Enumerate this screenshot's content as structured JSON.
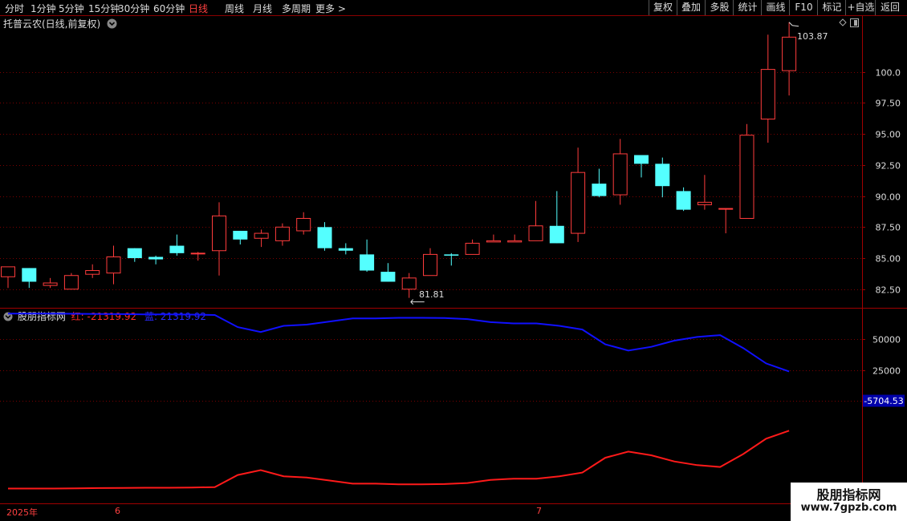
{
  "toolbar": {
    "periods": [
      "分时",
      "1分钟",
      "5分钟",
      "15分钟",
      "30分钟",
      "60分钟",
      "日线",
      "周线",
      "月线",
      "多周期",
      "更多 >"
    ],
    "active_period": "日线",
    "right_buttons": [
      "复权",
      "叠加",
      "多股",
      "统计",
      "画线",
      "F10",
      "标记",
      "+自选",
      "返回"
    ]
  },
  "main_panel": {
    "title": "托普云农(日线,前复权)",
    "y_ticks": [
      "100.0",
      "97.50",
      "95.00",
      "92.50",
      "90.00",
      "87.50",
      "85.00",
      "82.50"
    ],
    "high_label": "103.87",
    "low_label": "81.81"
  },
  "indicator_panel": {
    "name": "股朋指标网",
    "red_label": "红: -21319.92",
    "blue_label": "蓝: 21319.92",
    "y_ticks": [
      "50000",
      "25000"
    ],
    "current_value": "-5704.53"
  },
  "x_axis": {
    "year_label": "2025年",
    "month_labels": [
      "6",
      "7"
    ]
  },
  "watermark": {
    "title": "股朋指标网",
    "url": "www.7gpzb.com"
  },
  "colors": {
    "up": "#ff3c3c",
    "down": "#54ffff",
    "blue_line": "#1010ff",
    "red_line": "#ff1a1a",
    "grid": "#7a0000"
  },
  "chart_data": [
    {
      "type": "candlestick",
      "title": "托普云农(日线,前复权)",
      "ylim": [
        81,
        104.5
      ],
      "columns": [
        "open",
        "high",
        "low",
        "close"
      ],
      "candles": [
        [
          83.5,
          84.0,
          82.6,
          84.3
        ],
        [
          84.2,
          84.2,
          82.6,
          83.1
        ],
        [
          82.8,
          83.4,
          82.6,
          83.0
        ],
        [
          82.5,
          83.8,
          82.5,
          83.6
        ],
        [
          83.7,
          84.5,
          83.4,
          84.0
        ],
        [
          83.8,
          86.0,
          82.9,
          85.1
        ],
        [
          85.8,
          85.8,
          84.7,
          85.0
        ],
        [
          85.1,
          85.2,
          84.5,
          84.9
        ],
        [
          86.0,
          86.9,
          85.2,
          85.4
        ],
        [
          85.4,
          85.5,
          84.8,
          85.4
        ],
        [
          85.6,
          89.5,
          83.6,
          88.4
        ],
        [
          87.2,
          87.2,
          86.1,
          86.5
        ],
        [
          86.6,
          87.3,
          85.9,
          87.0
        ],
        [
          86.4,
          87.8,
          86.0,
          87.5
        ],
        [
          87.2,
          88.7,
          86.9,
          88.2
        ],
        [
          87.5,
          87.9,
          85.6,
          85.8
        ],
        [
          85.8,
          86.2,
          85.3,
          85.6
        ],
        [
          85.3,
          86.5,
          83.9,
          84.0
        ],
        [
          83.9,
          84.6,
          83.1,
          83.1
        ],
        [
          82.5,
          83.8,
          81.8,
          83.4
        ],
        [
          83.6,
          85.8,
          83.6,
          85.3
        ],
        [
          85.3,
          85.4,
          84.4,
          85.2
        ],
        [
          85.3,
          86.5,
          85.3,
          86.2
        ],
        [
          86.3,
          86.9,
          86.3,
          86.4
        ],
        [
          86.3,
          86.9,
          86.3,
          86.4
        ],
        [
          86.4,
          89.6,
          86.4,
          87.6
        ],
        [
          87.6,
          90.4,
          86.2,
          86.2
        ],
        [
          87.0,
          93.9,
          86.3,
          91.9
        ],
        [
          91.0,
          92.2,
          89.9,
          90.0
        ],
        [
          90.1,
          94.6,
          89.3,
          93.4
        ],
        [
          93.3,
          93.3,
          91.5,
          92.6
        ],
        [
          92.6,
          93.1,
          89.9,
          90.8
        ],
        [
          90.4,
          90.7,
          88.8,
          88.9
        ],
        [
          89.3,
          91.7,
          88.9,
          89.5
        ],
        [
          89.0,
          89.0,
          87.0,
          89.0
        ],
        [
          88.2,
          95.8,
          88.2,
          94.9
        ],
        [
          96.2,
          103.0,
          94.3,
          100.2
        ],
        [
          100.1,
          104.0,
          98.1,
          102.8
        ]
      ]
    },
    {
      "type": "line",
      "series": [
        {
          "name": "蓝",
          "values": [
            71000,
            71000,
            71000,
            70800,
            70600,
            70500,
            70300,
            70300,
            70100,
            69800,
            60000,
            56000,
            61000,
            62000,
            64500,
            67000,
            67000,
            67500,
            67500,
            67300,
            66500,
            64000,
            63000,
            63000,
            61000,
            58000,
            46000,
            41000,
            44000,
            49000,
            52000,
            53500,
            43000,
            30500,
            24000
          ]
        },
        {
          "name": "红",
          "values": [
            -71000,
            -71000,
            -71000,
            -70800,
            -70600,
            -70500,
            -70300,
            -70300,
            -70100,
            -69800,
            -60000,
            -56000,
            -61000,
            -62000,
            -64500,
            -67000,
            -67000,
            -67500,
            -67500,
            -67300,
            -66500,
            -64000,
            -63000,
            -63000,
            -61000,
            -58000,
            -46000,
            -41000,
            -44000,
            -49000,
            -52000,
            -53500,
            -43000,
            -30500,
            -24000
          ]
        }
      ],
      "y_ticks": [
        50000,
        25000
      ]
    }
  ]
}
